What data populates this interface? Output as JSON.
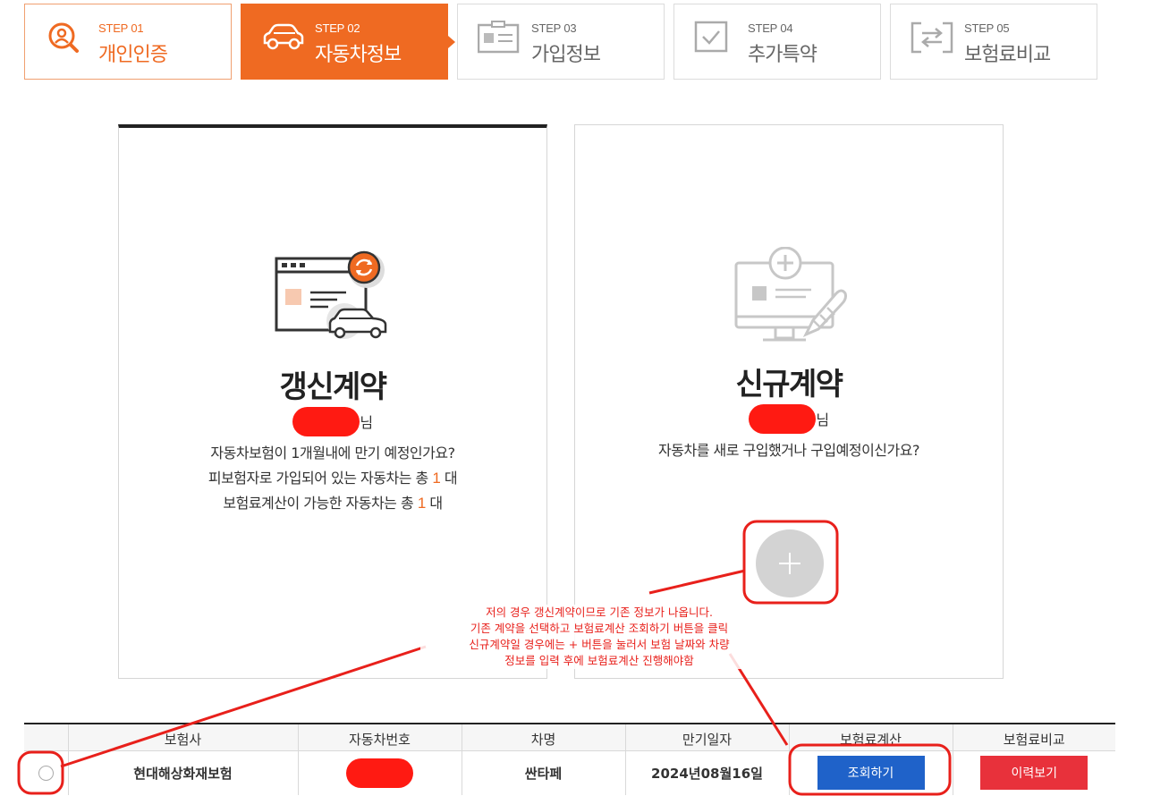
{
  "steps": [
    {
      "num": "STEP 01",
      "label": "개인인증"
    },
    {
      "num": "STEP 02",
      "label": "자동차정보"
    },
    {
      "num": "STEP 03",
      "label": "가입정보"
    },
    {
      "num": "STEP 04",
      "label": "추가특약"
    },
    {
      "num": "STEP 05",
      "label": "보험료비교"
    }
  ],
  "colors": {
    "accent": "#ef6a22",
    "blue": "#1f62c9",
    "red": "#e8313b",
    "annotation": "#e8201b"
  },
  "renewal": {
    "title": "갱신계약",
    "suffix": "님",
    "line1": "자동차보험이 1개월내에 만기 예정인가요?",
    "line2_pre": "피보험자로 가입되어 있는 자동차는 총",
    "line2_count": "1",
    "line2_post": "대",
    "line3_pre": "보험료계산이 가능한 자동차는 총",
    "line3_count": "1",
    "line3_post": "대"
  },
  "new_contract": {
    "title": "신규계약",
    "suffix": "님",
    "line1": "자동차를 새로 구입했거나 구입예정이신가요?",
    "add_icon": "plus-icon"
  },
  "annotation": {
    "lines": [
      "저의 경우 갱신계약이므로 기존 정보가 나옵니다.",
      "기존 계약을 선택하고 보험료계산 조회하기 버튼을 클릭",
      "신규계약일 경우에는 + 버튼을 눌러서 보험 날짜와 차량",
      "정보를 입력 후에 보험료계산 진행해야함"
    ]
  },
  "table": {
    "headers": [
      "",
      "보험사",
      "자동차번호",
      "차명",
      "만기일자",
      "보험료계산",
      "보험료비교"
    ],
    "row": {
      "insurer": "현대해상화재보험",
      "car_name": "싼타페",
      "expiry": "2024년08월16일",
      "calc_button": "조회하기",
      "compare_button": "이력보기"
    }
  }
}
